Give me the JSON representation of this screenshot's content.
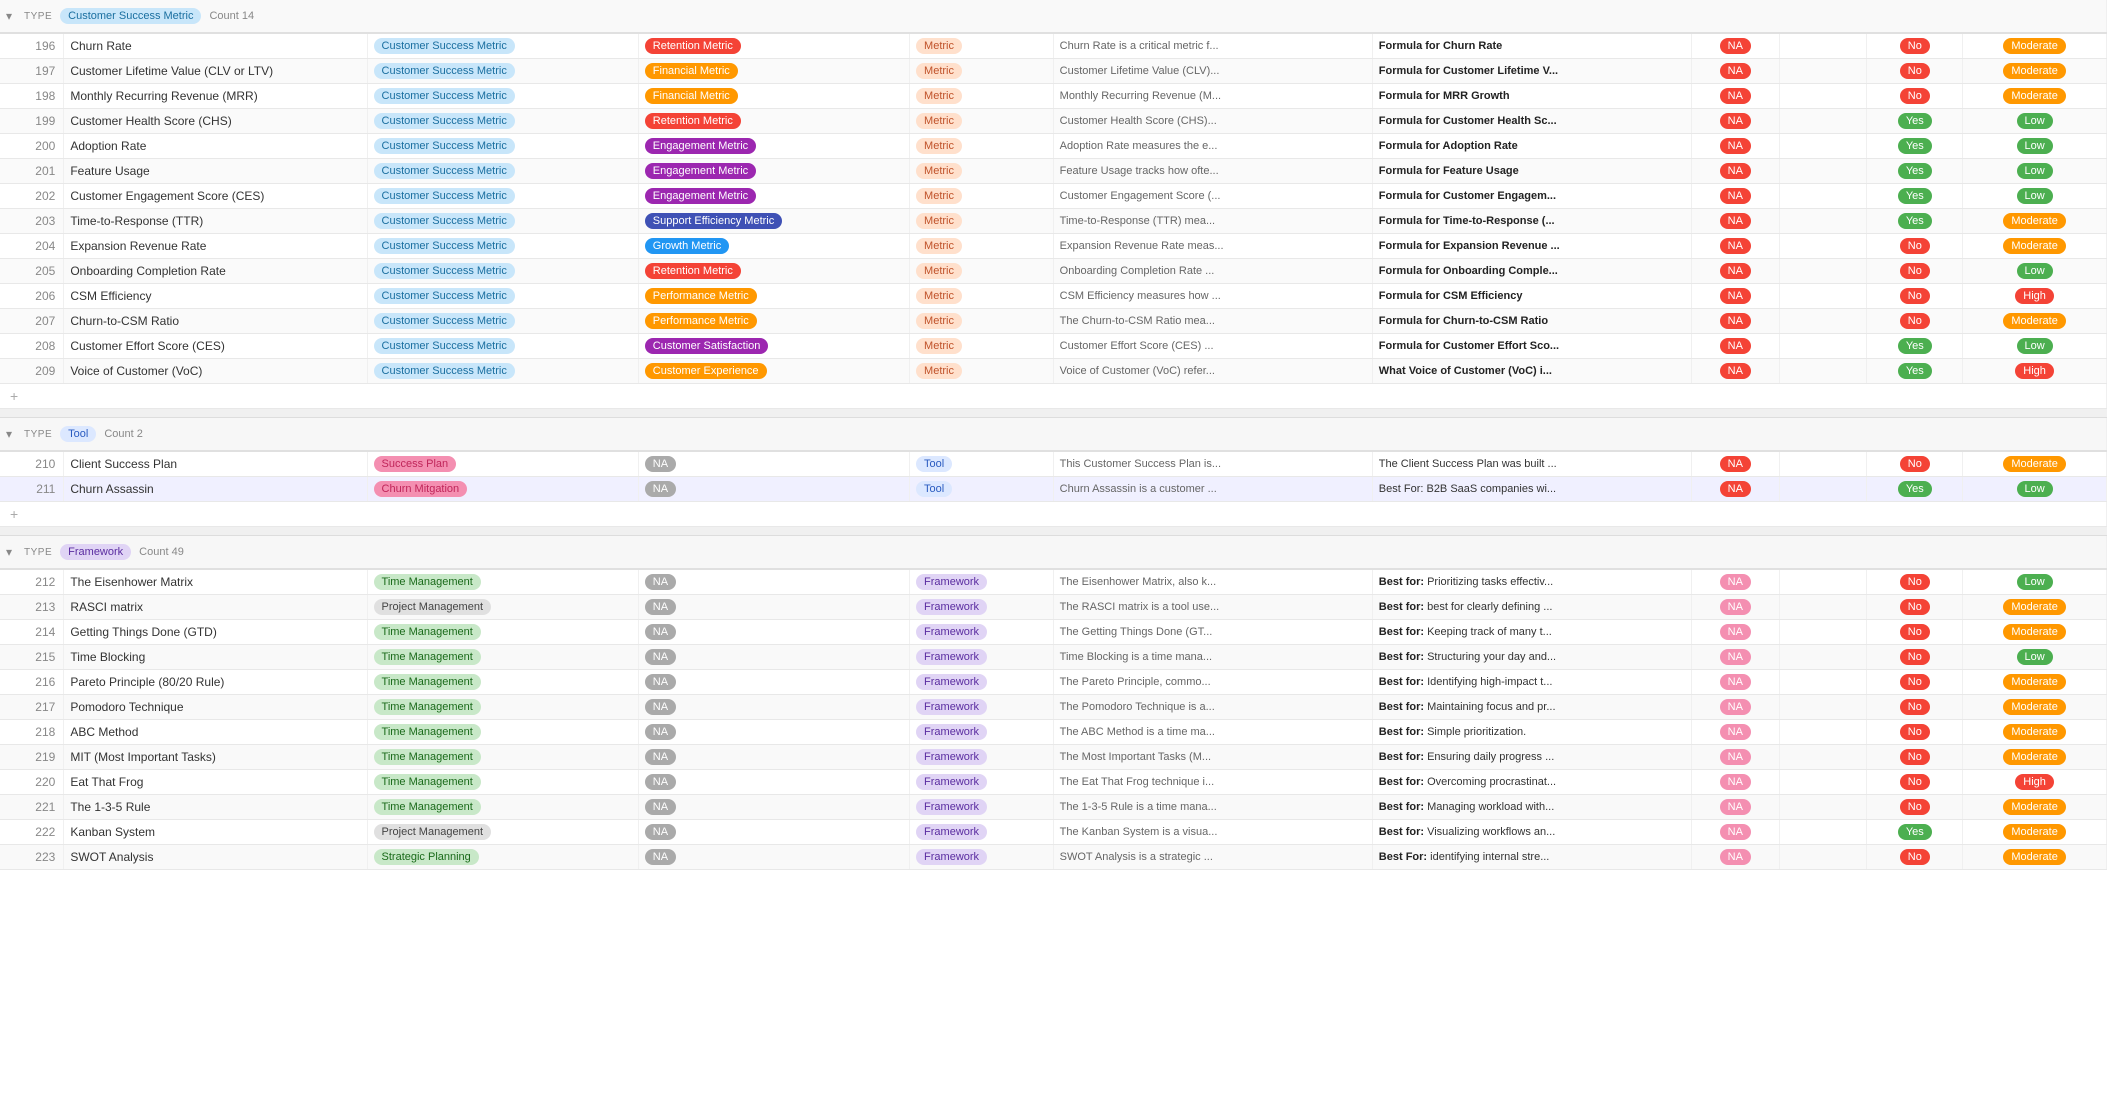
{
  "colors": {
    "csm_badge": "#c8e6fa",
    "metric_badge": "#ffe0cc",
    "low": "#4caf50",
    "moderate": "#ff9800",
    "high": "#f44336"
  },
  "groups": [
    {
      "id": "csm-group",
      "type_label": "TYPE",
      "type_name": "Customer Success Metric",
      "type_badge_class": "badge-csm",
      "count": 14,
      "rows": [
        {
          "num": 196,
          "name": "Churn Rate",
          "category": "Customer Success Metric",
          "subcategory": "Retention Metric",
          "sub_class": "badge-retention",
          "type": "Metric",
          "desc": "Churn Rate is a critical metric f...",
          "formula": "Formula for Churn Rate",
          "na": "NA",
          "na_class": "badge-na-red",
          "yn": "No",
          "yn_class": "badge-no",
          "priority": "Moderate",
          "priority_class": "badge-moderate"
        },
        {
          "num": 197,
          "name": "Customer Lifetime Value (CLV or LTV)",
          "category": "Customer Success Metric",
          "subcategory": "Financial Metric",
          "sub_class": "badge-financial",
          "type": "Metric",
          "desc": "Customer Lifetime Value (CLV)...",
          "formula": "Formula for Customer Lifetime V...",
          "na": "NA",
          "na_class": "badge-na-red",
          "yn": "No",
          "yn_class": "badge-no",
          "priority": "Moderate",
          "priority_class": "badge-moderate"
        },
        {
          "num": 198,
          "name": "Monthly Recurring Revenue (MRR)",
          "category": "Customer Success Metric",
          "subcategory": "Financial Metric",
          "sub_class": "badge-financial",
          "type": "Metric",
          "desc": "Monthly Recurring Revenue (M...",
          "formula": "Formula for MRR Growth",
          "na": "NA",
          "na_class": "badge-na-red",
          "yn": "No",
          "yn_class": "badge-no",
          "priority": "Moderate",
          "priority_class": "badge-moderate"
        },
        {
          "num": 199,
          "name": "Customer Health Score (CHS)",
          "category": "Customer Success Metric",
          "subcategory": "Retention Metric",
          "sub_class": "badge-retention",
          "type": "Metric",
          "desc": "Customer Health Score (CHS)...",
          "formula": "Formula for Customer Health Sc...",
          "na": "NA",
          "na_class": "badge-na-red",
          "yn": "Yes",
          "yn_class": "badge-yes",
          "priority": "Low",
          "priority_class": "badge-low"
        },
        {
          "num": 200,
          "name": "Adoption Rate",
          "category": "Customer Success Metric",
          "subcategory": "Engagement Metric",
          "sub_class": "badge-engagement",
          "type": "Metric",
          "desc": "Adoption Rate measures the e...",
          "formula": "Formula for Adoption Rate",
          "na": "NA",
          "na_class": "badge-na-red",
          "yn": "Yes",
          "yn_class": "badge-yes",
          "priority": "Low",
          "priority_class": "badge-low"
        },
        {
          "num": 201,
          "name": "Feature Usage",
          "category": "Customer Success Metric",
          "subcategory": "Engagement Metric",
          "sub_class": "badge-engagement",
          "type": "Metric",
          "desc": "Feature Usage tracks how ofte...",
          "formula": "Formula for Feature Usage",
          "na": "NA",
          "na_class": "badge-na-red",
          "yn": "Yes",
          "yn_class": "badge-yes",
          "priority": "Low",
          "priority_class": "badge-low"
        },
        {
          "num": 202,
          "name": "Customer Engagement Score (CES)",
          "category": "Customer Success Metric",
          "subcategory": "Engagement Metric",
          "sub_class": "badge-engagement",
          "type": "Metric",
          "desc": "Customer Engagement Score (...",
          "formula": "Formula for Customer Engagem...",
          "na": "NA",
          "na_class": "badge-na-red",
          "yn": "Yes",
          "yn_class": "badge-yes",
          "priority": "Low",
          "priority_class": "badge-low"
        },
        {
          "num": 203,
          "name": "Time-to-Response (TTR)",
          "category": "Customer Success Metric",
          "subcategory": "Support Efficiency Metric",
          "sub_class": "badge-support",
          "type": "Metric",
          "desc": "Time-to-Response (TTR) mea...",
          "formula": "Formula for Time-to-Response (...",
          "na": "NA",
          "na_class": "badge-na-red",
          "yn": "Yes",
          "yn_class": "badge-yes",
          "priority": "Moderate",
          "priority_class": "badge-moderate"
        },
        {
          "num": 204,
          "name": "Expansion Revenue Rate",
          "category": "Customer Success Metric",
          "subcategory": "Growth Metric",
          "sub_class": "badge-growth",
          "type": "Metric",
          "desc": "Expansion Revenue Rate meas...",
          "formula": "Formula for Expansion Revenue ...",
          "na": "NA",
          "na_class": "badge-na-red",
          "yn": "No",
          "yn_class": "badge-no",
          "priority": "Moderate",
          "priority_class": "badge-moderate"
        },
        {
          "num": 205,
          "name": "Onboarding Completion Rate",
          "category": "Customer Success Metric",
          "subcategory": "Retention Metric",
          "sub_class": "badge-retention",
          "type": "Metric",
          "desc": "Onboarding Completion Rate ...",
          "formula": "Formula for Onboarding Comple...",
          "na": "NA",
          "na_class": "badge-na-red",
          "yn": "No",
          "yn_class": "badge-no",
          "priority": "Low",
          "priority_class": "badge-low"
        },
        {
          "num": 206,
          "name": "CSM Efficiency",
          "category": "Customer Success Metric",
          "subcategory": "Performance Metric",
          "sub_class": "badge-performance",
          "type": "Metric",
          "desc": "CSM Efficiency measures how ...",
          "formula": "Formula for CSM Efficiency",
          "na": "NA",
          "na_class": "badge-na-red",
          "yn": "No",
          "yn_class": "badge-no",
          "priority": "High",
          "priority_class": "badge-high"
        },
        {
          "num": 207,
          "name": "Churn-to-CSM Ratio",
          "category": "Customer Success Metric",
          "subcategory": "Performance Metric",
          "sub_class": "badge-performance",
          "type": "Metric",
          "desc": "The Churn-to-CSM Ratio mea...",
          "formula": "Formula for Churn-to-CSM Ratio",
          "na": "NA",
          "na_class": "badge-na-red",
          "yn": "No",
          "yn_class": "badge-no",
          "priority": "Moderate",
          "priority_class": "badge-moderate"
        },
        {
          "num": 208,
          "name": "Customer Effort Score (CES)",
          "category": "Customer Success Metric",
          "subcategory": "Customer Satisfaction",
          "sub_class": "badge-cust-sat",
          "type": "Metric",
          "desc": "Customer Effort Score (CES) ...",
          "formula": "Formula for Customer Effort Sco...",
          "na": "NA",
          "na_class": "badge-na-red",
          "yn": "Yes",
          "yn_class": "badge-yes",
          "priority": "Low",
          "priority_class": "badge-low"
        },
        {
          "num": 209,
          "name": "Voice of Customer (VoC)",
          "category": "Customer Success Metric",
          "subcategory": "Customer Experience",
          "sub_class": "badge-cust-exp",
          "type": "Metric",
          "desc": "Voice of Customer (VoC) refer...",
          "formula": "What Voice of Customer (VoC) i...",
          "na": "NA",
          "na_class": "badge-na-red",
          "yn": "Yes",
          "yn_class": "badge-yes",
          "priority": "High",
          "priority_class": "badge-high"
        }
      ]
    },
    {
      "id": "tool-group",
      "type_label": "TYPE",
      "type_name": "Tool",
      "type_badge_class": "badge-tool",
      "count": 2,
      "rows": [
        {
          "num": 210,
          "name": "Client Success Plan",
          "category": "Success Plan",
          "cat_class": "badge-success-plan",
          "subcategory": "NA",
          "sub_class": "badge-na-gray",
          "type": "Tool",
          "desc": "This Customer Success Plan is...",
          "formula": "The Client Success Plan was built ...",
          "na": "NA",
          "na_class": "badge-na-red",
          "yn": "No",
          "yn_class": "badge-no",
          "priority": "Moderate",
          "priority_class": "badge-moderate"
        },
        {
          "num": 211,
          "name": "Churn Assassin",
          "category": "Churn Mitgation",
          "cat_class": "badge-churn-mit",
          "subcategory": "NA",
          "sub_class": "badge-na-gray",
          "type": "Tool",
          "desc": "Churn Assassin is a customer ...",
          "formula": "Best For: B2B SaaS companies wi...",
          "na": "NA",
          "na_class": "badge-na-red",
          "yn": "Yes",
          "yn_class": "badge-yes",
          "priority": "Low",
          "priority_class": "badge-low"
        }
      ]
    },
    {
      "id": "framework-group",
      "type_label": "TYPE",
      "type_name": "Framework",
      "type_badge_class": "badge-framework",
      "count": 49,
      "rows": [
        {
          "num": 212,
          "name": "The Eisenhower Matrix",
          "category": "Time Management",
          "cat_class": "badge-time-mgmt",
          "subcategory": "NA",
          "sub_class": "badge-na-gray",
          "type": "Framework",
          "desc": "The Eisenhower Matrix, also k...",
          "formula": "Best for: Prioritizing tasks effectiv...",
          "na": "NA",
          "na_class": "badge-na-pink",
          "yn": "No",
          "yn_class": "badge-no",
          "priority": "Low",
          "priority_class": "badge-low"
        },
        {
          "num": 213,
          "name": "RASCI matrix",
          "category": "Project Management",
          "cat_class": "badge-project-mgmt",
          "subcategory": "NA",
          "sub_class": "badge-na-gray",
          "type": "Framework",
          "desc": "The RASCI matrix is a tool use...",
          "formula": "Best for: best for clearly defining ...",
          "na": "NA",
          "na_class": "badge-na-pink",
          "yn": "No",
          "yn_class": "badge-no",
          "priority": "Moderate",
          "priority_class": "badge-moderate"
        },
        {
          "num": 214,
          "name": "Getting Things Done (GTD)",
          "category": "Time Management",
          "cat_class": "badge-time-mgmt",
          "subcategory": "NA",
          "sub_class": "badge-na-gray",
          "type": "Framework",
          "desc": "The Getting Things Done (GT...",
          "formula": "Best for: Keeping track of many t...",
          "na": "NA",
          "na_class": "badge-na-pink",
          "yn": "No",
          "yn_class": "badge-no",
          "priority": "Moderate",
          "priority_class": "badge-moderate"
        },
        {
          "num": 215,
          "name": "Time Blocking",
          "category": "Time Management",
          "cat_class": "badge-time-mgmt",
          "subcategory": "NA",
          "sub_class": "badge-na-gray",
          "type": "Framework",
          "desc": "Time Blocking is a time mana...",
          "formula": "Best for: Structuring your day and...",
          "na": "NA",
          "na_class": "badge-na-pink",
          "yn": "No",
          "yn_class": "badge-no",
          "priority": "Low",
          "priority_class": "badge-low"
        },
        {
          "num": 216,
          "name": "Pareto Principle (80/20 Rule)",
          "category": "Time Management",
          "cat_class": "badge-time-mgmt",
          "subcategory": "NA",
          "sub_class": "badge-na-gray",
          "type": "Framework",
          "desc": "The Pareto Principle, commo...",
          "formula": "Best for: Identifying high-impact t...",
          "na": "NA",
          "na_class": "badge-na-pink",
          "yn": "No",
          "yn_class": "badge-no",
          "priority": "Moderate",
          "priority_class": "badge-moderate"
        },
        {
          "num": 217,
          "name": "Pomodoro Technique",
          "category": "Time Management",
          "cat_class": "badge-time-mgmt",
          "subcategory": "NA",
          "sub_class": "badge-na-gray",
          "type": "Framework",
          "desc": "The Pomodoro Technique is a...",
          "formula": "Best for: Maintaining focus and pr...",
          "na": "NA",
          "na_class": "badge-na-pink",
          "yn": "No",
          "yn_class": "badge-no",
          "priority": "Moderate",
          "priority_class": "badge-moderate"
        },
        {
          "num": 218,
          "name": "ABC Method",
          "category": "Time Management",
          "cat_class": "badge-time-mgmt",
          "subcategory": "NA",
          "sub_class": "badge-na-gray",
          "type": "Framework",
          "desc": "The ABC Method is a time ma...",
          "formula": "Best for: Simple prioritization.",
          "na": "NA",
          "na_class": "badge-na-pink",
          "yn": "No",
          "yn_class": "badge-no",
          "priority": "Moderate",
          "priority_class": "badge-moderate"
        },
        {
          "num": 219,
          "name": "MIT (Most Important Tasks)",
          "category": "Time Management",
          "cat_class": "badge-time-mgmt",
          "subcategory": "NA",
          "sub_class": "badge-na-gray",
          "type": "Framework",
          "desc": "The Most Important Tasks (M...",
          "formula": "Best for: Ensuring daily progress ...",
          "na": "NA",
          "na_class": "badge-na-pink",
          "yn": "No",
          "yn_class": "badge-no",
          "priority": "Moderate",
          "priority_class": "badge-moderate"
        },
        {
          "num": 220,
          "name": "Eat That Frog",
          "category": "Time Management",
          "cat_class": "badge-time-mgmt",
          "subcategory": "NA",
          "sub_class": "badge-na-gray",
          "type": "Framework",
          "desc": "The Eat That Frog technique i...",
          "formula": "Best for: Overcoming procrastinat...",
          "na": "NA",
          "na_class": "badge-na-pink",
          "yn": "No",
          "yn_class": "badge-no",
          "priority": "High",
          "priority_class": "badge-high"
        },
        {
          "num": 221,
          "name": "The 1-3-5 Rule",
          "category": "Time Management",
          "cat_class": "badge-time-mgmt",
          "subcategory": "NA",
          "sub_class": "badge-na-gray",
          "type": "Framework",
          "desc": "The 1-3-5 Rule is a time mana...",
          "formula": "Best for: Managing workload with...",
          "na": "NA",
          "na_class": "badge-na-pink",
          "yn": "No",
          "yn_class": "badge-no",
          "priority": "Moderate",
          "priority_class": "badge-moderate"
        },
        {
          "num": 222,
          "name": "Kanban System",
          "category": "Project Management",
          "cat_class": "badge-project-mgmt",
          "subcategory": "NA",
          "sub_class": "badge-na-gray",
          "type": "Framework",
          "desc": "The Kanban System is a visua...",
          "formula": "Best for: Visualizing workflows an...",
          "na": "NA",
          "na_class": "badge-na-pink",
          "yn": "Yes",
          "yn_class": "badge-yes",
          "priority": "Moderate",
          "priority_class": "badge-moderate"
        },
        {
          "num": 223,
          "name": "SWOT Analysis",
          "category": "Strategic Planning",
          "cat_class": "badge-strategic",
          "subcategory": "NA",
          "sub_class": "badge-na-gray",
          "type": "Framework",
          "desc": "SWOT Analysis is a strategic ...",
          "formula": "Best For: identifying internal stre...",
          "na": "NA",
          "na_class": "badge-na-pink",
          "yn": "No",
          "yn_class": "badge-no",
          "priority": "Moderate",
          "priority_class": "badge-moderate"
        }
      ]
    }
  ],
  "add_row_label": "+",
  "expand_icon": "▾"
}
